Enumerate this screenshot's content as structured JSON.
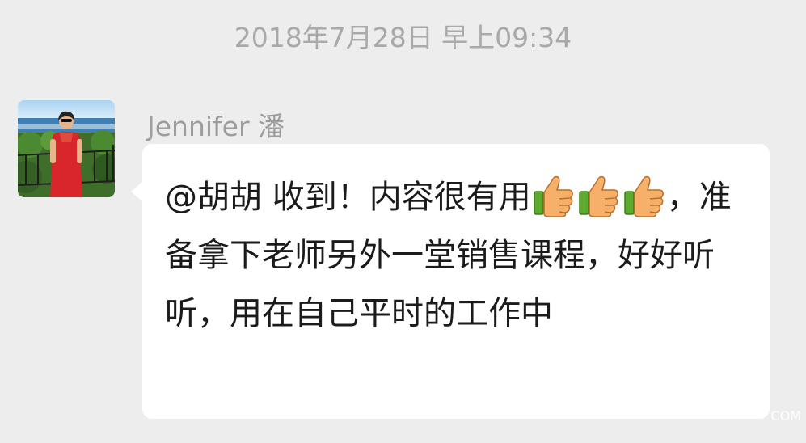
{
  "timestamp": "2018年7月28日 早上09:34",
  "message": {
    "sender": "Jennifer 潘",
    "segments": [
      {
        "type": "text",
        "value": "@胡胡  收到！内容很有用"
      },
      {
        "type": "emoji",
        "name": "thumbs-up-icon"
      },
      {
        "type": "emoji",
        "name": "thumbs-up-icon"
      },
      {
        "type": "emoji",
        "name": "thumbs-up-icon"
      },
      {
        "type": "text",
        "value": "，准备拿下老师另外一堂销售课程，好好听听，用在自己平时的工作中"
      }
    ]
  },
  "watermark": "COM",
  "colors": {
    "background": "#ededed",
    "bubble": "#ffffff",
    "timestamp": "#a9a9a9",
    "sender_name": "#9d9d9d",
    "thumb_hand": "#f6b06a",
    "thumb_cuff": "#5daa2f"
  }
}
